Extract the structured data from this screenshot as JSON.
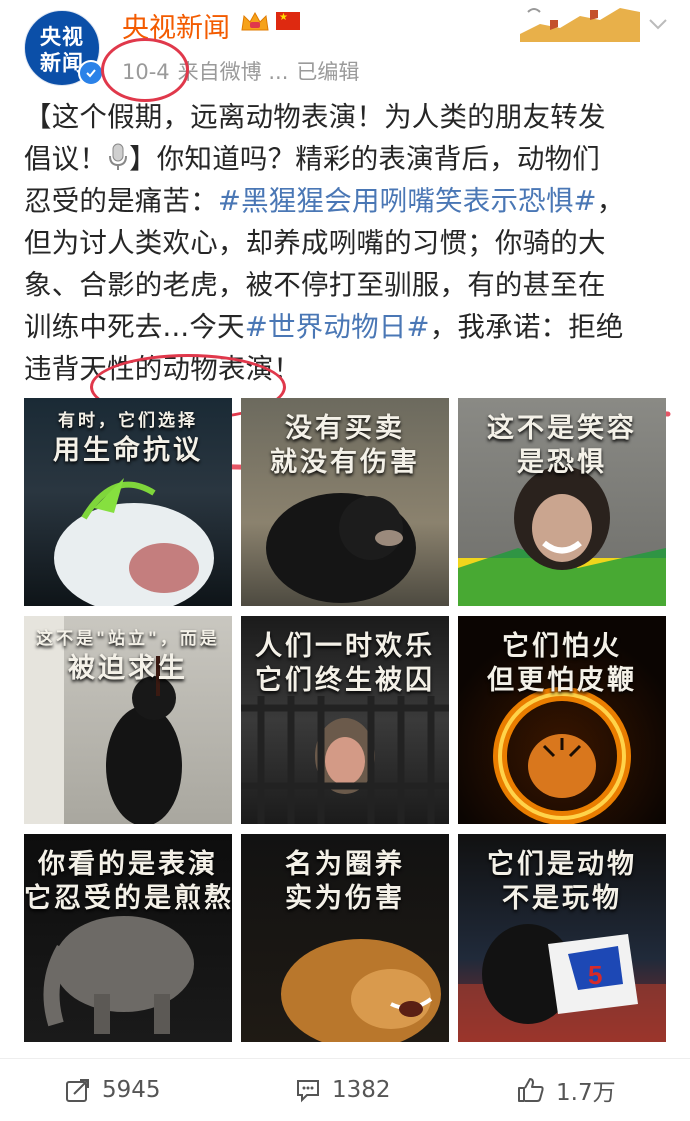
{
  "header": {
    "avatar_line1": "央视",
    "avatar_line2": "新闻",
    "author": "央视新闻",
    "date": "10-4",
    "source": "来自微博 ...",
    "edited": "已编辑"
  },
  "post": {
    "lines": [
      [
        {
          "t": "【这个假期，远离动物表演！为人类的朋友转发"
        }
      ],
      [
        {
          "t": "倡议！"
        },
        {
          "icon": "microphone"
        },
        {
          "t": "】你知道吗？精彩的表演背后，动物们"
        }
      ],
      [
        {
          "t": "忍受的是痛苦："
        },
        {
          "t": "#黑猩猩会用咧嘴笑表示恐惧#",
          "tag": true
        },
        {
          "t": "，"
        }
      ],
      [
        {
          "t": "但为讨人类欢心，却养成咧嘴的习惯；你骑的大"
        }
      ],
      [
        {
          "t": "象、合影的老虎，被不停打至驯服，有的甚至在"
        }
      ],
      [
        {
          "t": "训练中死去...今天"
        },
        {
          "t": "#世界动物日#",
          "tag": true
        },
        {
          "t": "，我承诺：拒绝"
        }
      ],
      [
        {
          "t": "违背天性的动物表演！"
        }
      ]
    ]
  },
  "images": [
    {
      "caption": [
        "有时，它们选择",
        "用生命抗议"
      ],
      "name": "beluga"
    },
    {
      "caption": [
        "没有买卖",
        "就没有伤害"
      ],
      "name": "black-bear"
    },
    {
      "caption": [
        "这不是笑容",
        "是恐惧"
      ],
      "name": "chimpanzee"
    },
    {
      "caption": [
        "这不是\"站立\"，而是",
        "被迫求生"
      ],
      "name": "standing-bear"
    },
    {
      "caption": [
        "人们一时欢乐",
        "它们终生被囚"
      ],
      "name": "caged-monkey"
    },
    {
      "caption": [
        "它们怕火",
        "但更怕皮鞭"
      ],
      "name": "tiger-fire-ring"
    },
    {
      "caption": [
        "你看的是表演",
        "它忍受的是煎熬"
      ],
      "name": "elephant"
    },
    {
      "caption": [
        "名为圈养",
        "实为伤害"
      ],
      "name": "lion"
    },
    {
      "caption": [
        "它们是动物",
        "不是玩物"
      ],
      "name": "costumed-bear"
    }
  ],
  "actions": {
    "repost_count": "5945",
    "comment_count": "1382",
    "like_count": "1.7万"
  },
  "colors": {
    "author": "#f35b00",
    "hashtag": "#4a77b5",
    "annotation": "#e0384b",
    "meta": "#9a9a9a"
  }
}
